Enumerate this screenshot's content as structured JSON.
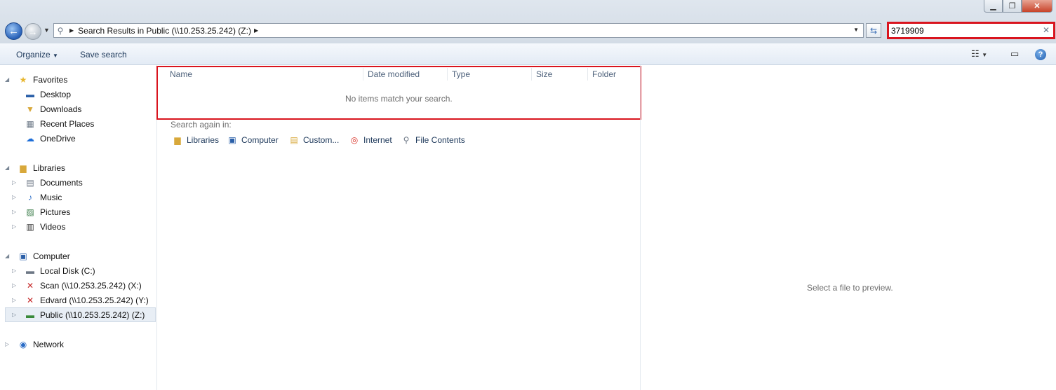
{
  "window": {
    "controls": [
      "minimize",
      "maximize",
      "close"
    ]
  },
  "address_bar": {
    "path": "Search Results in Public (\\\\10.253.25.242) (Z:)"
  },
  "search": {
    "value": "3719909"
  },
  "toolbar": {
    "organize_label": "Organize",
    "save_search_label": "Save search"
  },
  "nav": {
    "favorites": {
      "label": "Favorites",
      "items": [
        "Desktop",
        "Downloads",
        "Recent Places",
        "OneDrive"
      ]
    },
    "libraries": {
      "label": "Libraries",
      "items": [
        "Documents",
        "Music",
        "Pictures",
        "Videos"
      ]
    },
    "computer": {
      "label": "Computer",
      "items": [
        "Local Disk (C:)",
        "Scan (\\\\10.253.25.242) (X:)",
        "Edvard (\\\\10.253.25.242) (Y:)",
        "Public (\\\\10.253.25.242) (Z:)"
      ]
    },
    "network": {
      "label": "Network"
    }
  },
  "content": {
    "columns": [
      "Name",
      "Date modified",
      "Type",
      "Size",
      "Folder"
    ],
    "empty_message": "No items match your search.",
    "search_again_label": "Search again in:",
    "search_again_links": [
      "Libraries",
      "Computer",
      "Custom...",
      "Internet",
      "File Contents"
    ]
  },
  "preview": {
    "message": "Select a file to preview."
  },
  "colors": {
    "highlight": "#d9141e",
    "toolbar_text": "#1e395b"
  }
}
